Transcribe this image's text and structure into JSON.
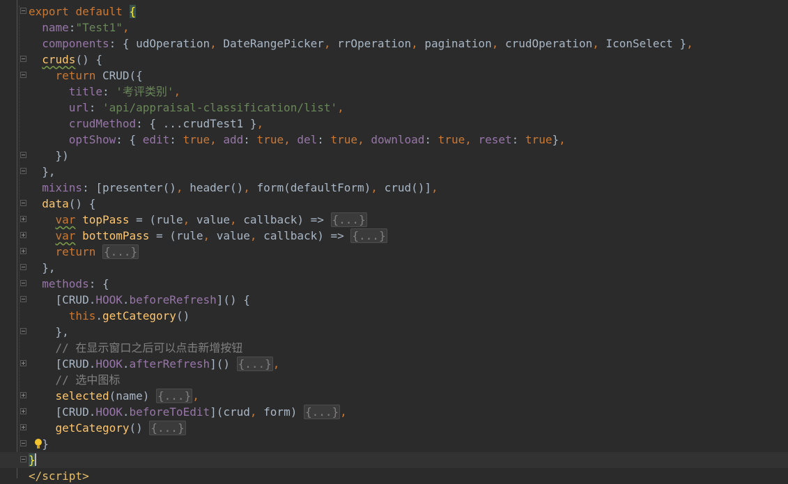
{
  "editor": {
    "language": "javascript",
    "current_line": 28,
    "lines": [
      {
        "fold": "minus",
        "tokens": [
          {
            "t": "export",
            "c": "kw"
          },
          {
            "t": " "
          },
          {
            "t": "default",
            "c": "kw"
          },
          {
            "t": " "
          },
          {
            "t": "{",
            "c": "brc"
          }
        ]
      },
      {
        "fold": null,
        "tokens": [
          {
            "t": "  "
          },
          {
            "t": "name",
            "c": "pr"
          },
          {
            "t": ":"
          },
          {
            "t": "\"Test1\"",
            "c": "st"
          },
          {
            "t": ",",
            "c": "pn"
          }
        ]
      },
      {
        "fold": null,
        "tokens": [
          {
            "t": "  "
          },
          {
            "t": "components",
            "c": "pr"
          },
          {
            "t": ": { udOperation"
          },
          {
            "t": ",",
            "c": "pn"
          },
          {
            "t": " DateRangePicker"
          },
          {
            "t": ",",
            "c": "pn"
          },
          {
            "t": " rrOperation"
          },
          {
            "t": ",",
            "c": "pn"
          },
          {
            "t": " pagination"
          },
          {
            "t": ",",
            "c": "pn"
          },
          {
            "t": " crudOperation"
          },
          {
            "t": ",",
            "c": "pn"
          },
          {
            "t": " IconSelect }"
          },
          {
            "t": ",",
            "c": "pn"
          }
        ]
      },
      {
        "fold": "minus",
        "tokens": [
          {
            "t": "  "
          },
          {
            "t": "cruds",
            "c": "fn ws"
          },
          {
            "t": "() {"
          }
        ]
      },
      {
        "fold": "minus",
        "tokens": [
          {
            "t": "    "
          },
          {
            "t": "return",
            "c": "kw"
          },
          {
            "t": " CRUD({"
          }
        ]
      },
      {
        "fold": null,
        "tokens": [
          {
            "t": "      "
          },
          {
            "t": "title",
            "c": "pr"
          },
          {
            "t": ": "
          },
          {
            "t": "'考评类别'",
            "c": "st"
          },
          {
            "t": ",",
            "c": "pn"
          }
        ]
      },
      {
        "fold": null,
        "tokens": [
          {
            "t": "      "
          },
          {
            "t": "url",
            "c": "pr"
          },
          {
            "t": ": "
          },
          {
            "t": "'api/appraisal-classification/list'",
            "c": "st"
          },
          {
            "t": ",",
            "c": "pn"
          }
        ]
      },
      {
        "fold": null,
        "tokens": [
          {
            "t": "      "
          },
          {
            "t": "crudMethod",
            "c": "pr"
          },
          {
            "t": ": { ...crudTest1 }"
          },
          {
            "t": ",",
            "c": "pn"
          }
        ]
      },
      {
        "fold": null,
        "tokens": [
          {
            "t": "      "
          },
          {
            "t": "optShow",
            "c": "pr"
          },
          {
            "t": ": { "
          },
          {
            "t": "edit",
            "c": "pr"
          },
          {
            "t": ": "
          },
          {
            "t": "true",
            "c": "kw"
          },
          {
            "t": ",",
            "c": "pn"
          },
          {
            "t": " "
          },
          {
            "t": "add",
            "c": "pr"
          },
          {
            "t": ": "
          },
          {
            "t": "true",
            "c": "kw"
          },
          {
            "t": ",",
            "c": "pn"
          },
          {
            "t": " "
          },
          {
            "t": "del",
            "c": "pr"
          },
          {
            "t": ": "
          },
          {
            "t": "true",
            "c": "kw"
          },
          {
            "t": ",",
            "c": "pn"
          },
          {
            "t": " "
          },
          {
            "t": "download",
            "c": "pr"
          },
          {
            "t": ": "
          },
          {
            "t": "true",
            "c": "kw"
          },
          {
            "t": ",",
            "c": "pn"
          },
          {
            "t": " "
          },
          {
            "t": "reset",
            "c": "pr"
          },
          {
            "t": ": "
          },
          {
            "t": "true",
            "c": "kw"
          },
          {
            "t": "}"
          },
          {
            "t": ",",
            "c": "pn"
          }
        ]
      },
      {
        "fold": "minus",
        "tokens": [
          {
            "t": "    })"
          }
        ]
      },
      {
        "fold": "minus",
        "tokens": [
          {
            "t": "  },"
          }
        ]
      },
      {
        "fold": null,
        "tokens": [
          {
            "t": "  "
          },
          {
            "t": "mixins",
            "c": "pr"
          },
          {
            "t": ": [presenter()"
          },
          {
            "t": ",",
            "c": "pn"
          },
          {
            "t": " header()"
          },
          {
            "t": ",",
            "c": "pn"
          },
          {
            "t": " form(defaultForm)"
          },
          {
            "t": ",",
            "c": "pn"
          },
          {
            "t": " crud()]"
          },
          {
            "t": ",",
            "c": "pn"
          }
        ]
      },
      {
        "fold": "minus",
        "tokens": [
          {
            "t": "  "
          },
          {
            "t": "data",
            "c": "fn"
          },
          {
            "t": "() {"
          }
        ]
      },
      {
        "fold": "plus",
        "tokens": [
          {
            "t": "    "
          },
          {
            "t": "var",
            "c": "kw ws"
          },
          {
            "t": " "
          },
          {
            "t": "topPass",
            "c": "fn"
          },
          {
            "t": " = (rule"
          },
          {
            "t": ",",
            "c": "pn"
          },
          {
            "t": " value"
          },
          {
            "t": ",",
            "c": "pn"
          },
          {
            "t": " callback) => "
          },
          {
            "t": "{...}",
            "c": "fd"
          }
        ]
      },
      {
        "fold": "plus",
        "tokens": [
          {
            "t": "    "
          },
          {
            "t": "var",
            "c": "kw ws"
          },
          {
            "t": " "
          },
          {
            "t": "bottomPass",
            "c": "fn"
          },
          {
            "t": " = (rule"
          },
          {
            "t": ",",
            "c": "pn"
          },
          {
            "t": " value"
          },
          {
            "t": ",",
            "c": "pn"
          },
          {
            "t": " callback) => "
          },
          {
            "t": "{...}",
            "c": "fd"
          }
        ]
      },
      {
        "fold": "plus",
        "tokens": [
          {
            "t": "    "
          },
          {
            "t": "return",
            "c": "kw"
          },
          {
            "t": " "
          },
          {
            "t": "{...}",
            "c": "fd"
          }
        ]
      },
      {
        "fold": "minus",
        "tokens": [
          {
            "t": "  },"
          }
        ]
      },
      {
        "fold": "minus",
        "tokens": [
          {
            "t": "  "
          },
          {
            "t": "methods",
            "c": "pr"
          },
          {
            "t": ": {"
          }
        ]
      },
      {
        "fold": "minus",
        "tokens": [
          {
            "t": "    [CRUD."
          },
          {
            "t": "HOOK",
            "c": "pr"
          },
          {
            "t": "."
          },
          {
            "t": "beforeRefresh",
            "c": "pr"
          },
          {
            "t": "]() {"
          }
        ]
      },
      {
        "fold": null,
        "tokens": [
          {
            "t": "      "
          },
          {
            "t": "this",
            "c": "kw"
          },
          {
            "t": "."
          },
          {
            "t": "getCategory",
            "c": "fn"
          },
          {
            "t": "()"
          }
        ]
      },
      {
        "fold": "minus",
        "tokens": [
          {
            "t": "    },"
          }
        ]
      },
      {
        "fold": null,
        "tokens": [
          {
            "t": "    "
          },
          {
            "t": "// 在显示窗口之后可以点击新增按钮",
            "c": "cm"
          }
        ]
      },
      {
        "fold": "plus",
        "tokens": [
          {
            "t": "    [CRUD."
          },
          {
            "t": "HOOK",
            "c": "pr"
          },
          {
            "t": "."
          },
          {
            "t": "afterRefresh",
            "c": "pr"
          },
          {
            "t": "]() "
          },
          {
            "t": "{...}",
            "c": "fd"
          },
          {
            "t": ",",
            "c": "pn"
          }
        ]
      },
      {
        "fold": null,
        "tokens": [
          {
            "t": "    "
          },
          {
            "t": "// 选中图标",
            "c": "cm"
          }
        ]
      },
      {
        "fold": "plus",
        "tokens": [
          {
            "t": "    "
          },
          {
            "t": "selected",
            "c": "fn"
          },
          {
            "t": "(name) "
          },
          {
            "t": "{...}",
            "c": "fd"
          },
          {
            "t": ",",
            "c": "pn"
          }
        ]
      },
      {
        "fold": "plus",
        "tokens": [
          {
            "t": "    [CRUD."
          },
          {
            "t": "HOOK",
            "c": "pr"
          },
          {
            "t": "."
          },
          {
            "t": "beforeToEdit",
            "c": "pr"
          },
          {
            "t": "](crud"
          },
          {
            "t": ",",
            "c": "pn"
          },
          {
            "t": " form) "
          },
          {
            "t": "{...}",
            "c": "fd"
          },
          {
            "t": ",",
            "c": "pn"
          }
        ]
      },
      {
        "fold": "plus",
        "tokens": [
          {
            "t": "    "
          },
          {
            "t": "getCategory",
            "c": "fn"
          },
          {
            "t": "() "
          },
          {
            "t": "{...}",
            "c": "fd"
          }
        ]
      },
      {
        "fold": "minus",
        "bulb": true,
        "tokens": [
          {
            "t": "  }"
          }
        ]
      },
      {
        "fold": "minus",
        "caret": true,
        "tokens": [
          {
            "t": "}",
            "c": "brc"
          }
        ]
      },
      {
        "fold": null,
        "tokens": [
          {
            "t": "</",
            "c": "tg"
          },
          {
            "t": "script",
            "c": "tg"
          },
          {
            "t": ">",
            "c": "tg"
          }
        ]
      }
    ]
  }
}
